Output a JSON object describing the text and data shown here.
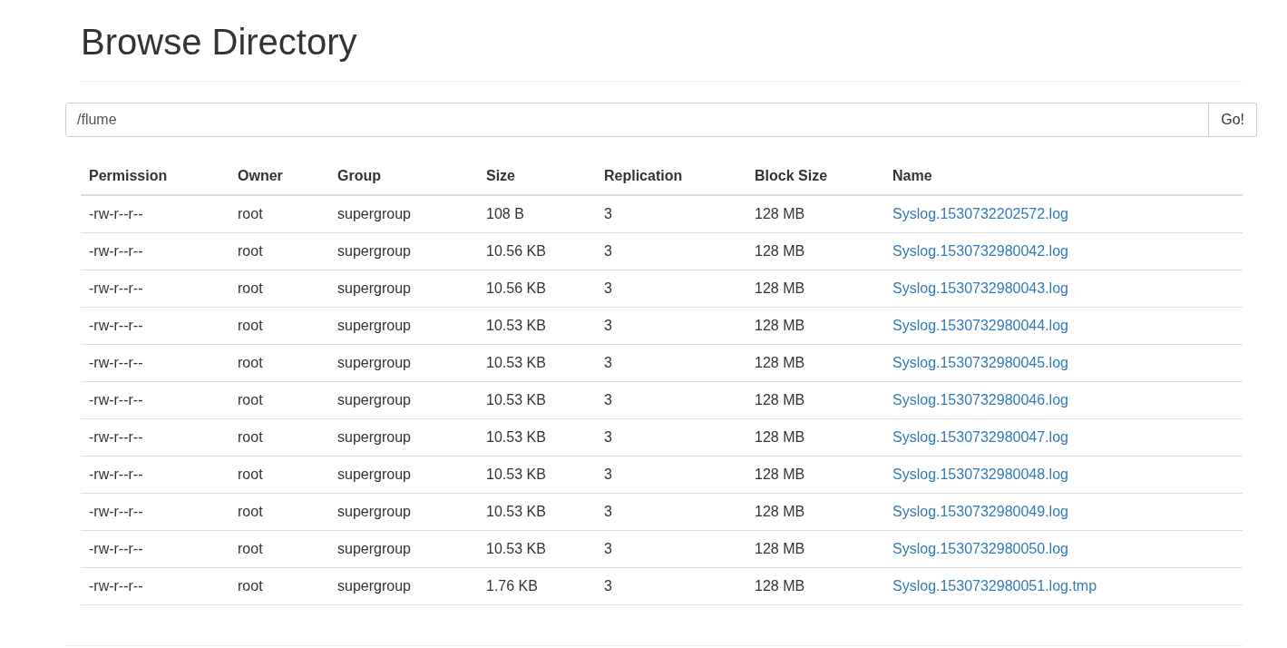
{
  "title": "Browse Directory",
  "path_field": {
    "value": "/flume"
  },
  "go_button": "Go!",
  "table": {
    "columns": [
      "Permission",
      "Owner",
      "Group",
      "Size",
      "Replication",
      "Block Size",
      "Name"
    ],
    "rows": [
      [
        "-rw-r--r--",
        "root",
        "supergroup",
        "108 B",
        "3",
        "128 MB",
        "Syslog.1530732202572.log"
      ],
      [
        "-rw-r--r--",
        "root",
        "supergroup",
        "10.56 KB",
        "3",
        "128 MB",
        "Syslog.1530732980042.log"
      ],
      [
        "-rw-r--r--",
        "root",
        "supergroup",
        "10.56 KB",
        "3",
        "128 MB",
        "Syslog.1530732980043.log"
      ],
      [
        "-rw-r--r--",
        "root",
        "supergroup",
        "10.53 KB",
        "3",
        "128 MB",
        "Syslog.1530732980044.log"
      ],
      [
        "-rw-r--r--",
        "root",
        "supergroup",
        "10.53 KB",
        "3",
        "128 MB",
        "Syslog.1530732980045.log"
      ],
      [
        "-rw-r--r--",
        "root",
        "supergroup",
        "10.53 KB",
        "3",
        "128 MB",
        "Syslog.1530732980046.log"
      ],
      [
        "-rw-r--r--",
        "root",
        "supergroup",
        "10.53 KB",
        "3",
        "128 MB",
        "Syslog.1530732980047.log"
      ],
      [
        "-rw-r--r--",
        "root",
        "supergroup",
        "10.53 KB",
        "3",
        "128 MB",
        "Syslog.1530732980048.log"
      ],
      [
        "-rw-r--r--",
        "root",
        "supergroup",
        "10.53 KB",
        "3",
        "128 MB",
        "Syslog.1530732980049.log"
      ],
      [
        "-rw-r--r--",
        "root",
        "supergroup",
        "10.53 KB",
        "3",
        "128 MB",
        "Syslog.1530732980050.log"
      ],
      [
        "-rw-r--r--",
        "root",
        "supergroup",
        "1.76 KB",
        "3",
        "128 MB",
        "Syslog.1530732980051.log.tmp"
      ]
    ]
  }
}
